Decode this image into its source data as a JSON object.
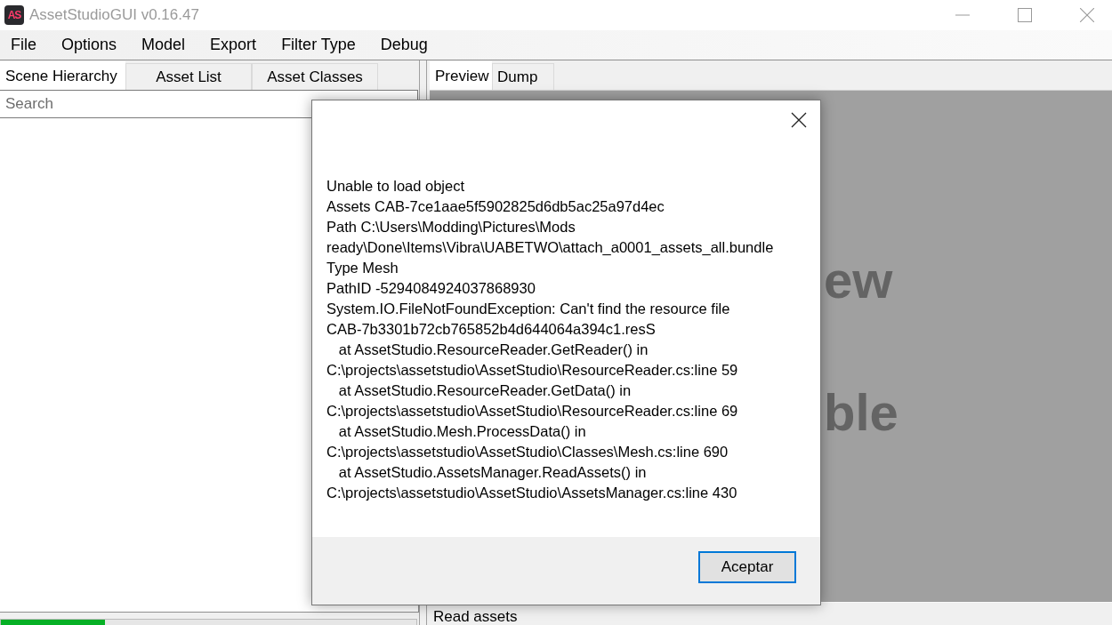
{
  "window": {
    "logo": "AS",
    "title": "AssetStudioGUI v0.16.47"
  },
  "menu_bar": {
    "items": [
      "File",
      "Options",
      "Model",
      "Export",
      "Filter Type",
      "Debug"
    ]
  },
  "left_panel": {
    "tabs": [
      {
        "label": "Scene Hierarchy",
        "selected": true
      },
      {
        "label": "Asset List",
        "selected": false
      },
      {
        "label": "Asset Classes",
        "selected": false
      }
    ],
    "search": {
      "placeholder": "Search"
    },
    "progress": {
      "level": 0.25
    }
  },
  "right_panel": {
    "tabs": [
      {
        "label": "Preview",
        "selected": true
      },
      {
        "label": "Dump",
        "selected": false
      }
    ],
    "preview_text": [
      "ew",
      "ble"
    ],
    "status_bar": {
      "text": "Read assets"
    }
  },
  "dialog": {
    "message_lines": [
      "Unable to load object",
      "Assets CAB-7ce1aae5f5902825d6db5ac25a97d4ec",
      "Path C:\\Users\\Modding\\Pictures\\Mods",
      "ready\\Done\\Items\\Vibra\\UABETWO\\attach_a0001_assets_all.bundle",
      "Type Mesh",
      "PathID -5294084924037868930",
      "System.IO.FileNotFoundException: Can't find the resource file",
      "CAB-7b3301b72cb765852b4d644064a394c1.resS",
      "   at AssetStudio.ResourceReader.GetReader() in",
      "C:\\projects\\assetstudio\\AssetStudio\\ResourceReader.cs:line 59",
      "   at AssetStudio.ResourceReader.GetData() in",
      "C:\\projects\\assetstudio\\AssetStudio\\ResourceReader.cs:line 69",
      "   at AssetStudio.Mesh.ProcessData() in",
      "C:\\projects\\assetstudio\\AssetStudio\\Classes\\Mesh.cs:line 690",
      "   at AssetStudio.AssetsManager.ReadAssets() in",
      "C:\\projects\\assetstudio\\AssetStudio\\AssetsManager.cs:line 430"
    ],
    "buttons": [
      {
        "label": "Aceptar",
        "focused": true
      }
    ]
  }
}
